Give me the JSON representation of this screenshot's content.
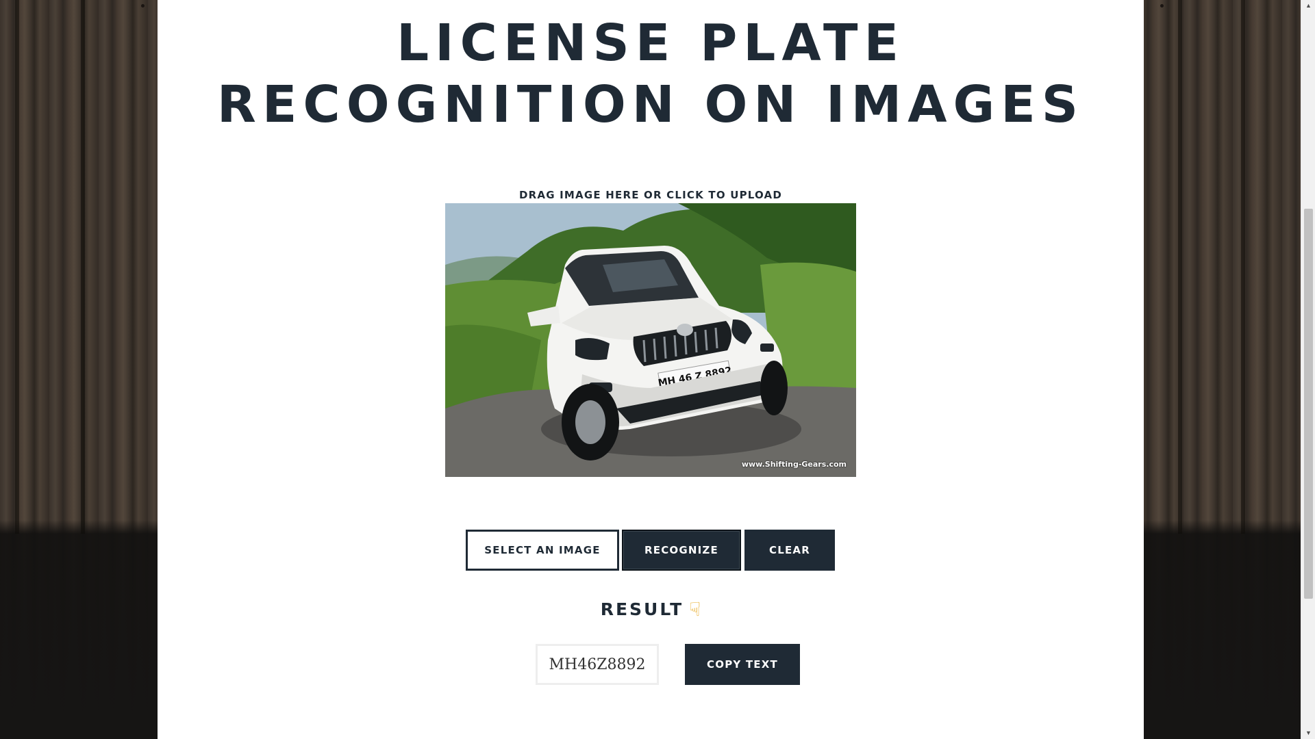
{
  "page": {
    "title_line1": "LICENSE PLATE",
    "title_line2": "RECOGNITION ON IMAGES",
    "upload_hint": "DRAG IMAGE HERE OR CLICK TO UPLOAD"
  },
  "image": {
    "plate_text": "MH 46 Z 8892",
    "watermark": "www.Shifting-Gears.com"
  },
  "buttons": {
    "select_label": "SELECT AN IMAGE",
    "recognize_label": "RECOGNIZE",
    "clear_label": "CLEAR",
    "copy_label": "COPY TEXT"
  },
  "result": {
    "heading": "RESULT",
    "hand_icon": "pointing-down-hand-icon",
    "value": "MH46Z8892"
  },
  "colors": {
    "primary_dark": "#1f2a35",
    "panel_bg": "#ffffff",
    "hand_emoji": "#e8a920"
  },
  "scrollbar": {
    "up_arrow_icon": "triangle-up-icon",
    "down_arrow_icon": "triangle-down-icon"
  }
}
